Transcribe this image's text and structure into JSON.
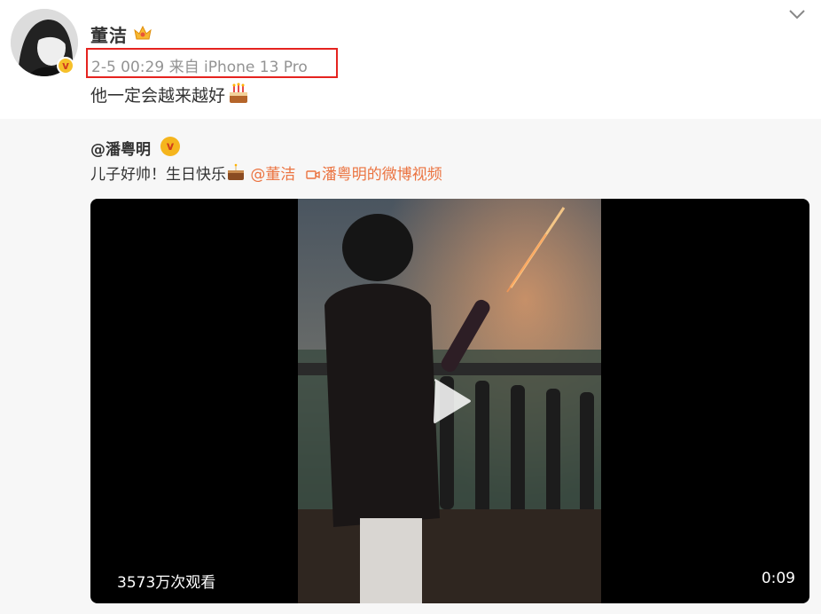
{
  "post": {
    "author": "董洁",
    "timestamp": "2-5 00:29",
    "source": "来自 iPhone 13 Pro",
    "text": "他一定会越来越好"
  },
  "repost": {
    "author": "@潘粤明",
    "text": "儿子好帅！生日快乐",
    "mention": "@董洁",
    "video_link": "潘粤明的微博视频",
    "video": {
      "views": "3573万次观看",
      "duration": "0:09"
    }
  },
  "colors": {
    "highlight_box": "#e5231f",
    "link": "#eb7340",
    "meta_gray": "#939393"
  },
  "icons": [
    "chevron-down-icon",
    "crown-icon",
    "verified-icon",
    "cake-icon",
    "play-icon",
    "video-camera-icon"
  ]
}
